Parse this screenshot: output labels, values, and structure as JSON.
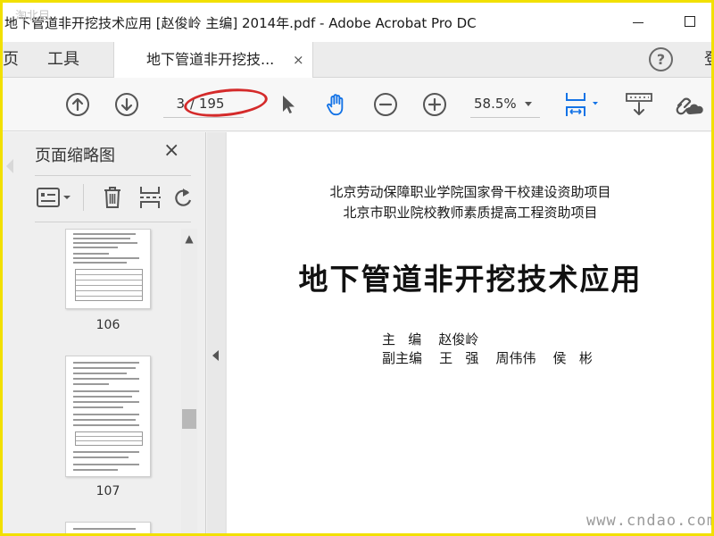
{
  "window": {
    "title": "地下管道非开挖技术应用 [赵俊岭 主编] 2014年.pdf - Adobe Acrobat Pro DC",
    "minimize_icon": "minimize-icon",
    "maximize_icon": "maximize-icon"
  },
  "tabs": {
    "home": "页",
    "tools": "工具",
    "document": "地下管道非开挖技...",
    "document_close": "×",
    "help": "?",
    "signin": "登"
  },
  "toolbar": {
    "prev_icon": "arrow-up-circle-icon",
    "next_icon": "arrow-down-circle-icon",
    "page_current": "3",
    "page_total": "/ 195",
    "select_icon": "cursor-arrow-icon",
    "hand_icon": "hand-tool-icon",
    "zoom_out_icon": "zoom-out-icon",
    "zoom_in_icon": "zoom-in-icon",
    "zoom_value": "58.5%",
    "fit_icon": "fit-page-icon",
    "scroll_icon": "scroll-mode-icon",
    "link_icon": "link-cloud-icon",
    "highlight_color": "#d42a2a",
    "accent_color": "#1473e6"
  },
  "thumbnails": {
    "title": "页面缩略图",
    "close": "×",
    "items": [
      {
        "page": "106"
      },
      {
        "page": "107"
      }
    ]
  },
  "document": {
    "subtitle_1": "北京劳动保障职业学院国家骨干校建设资助项目",
    "subtitle_2": "北京市职业院校教师素质提高工程资助项目",
    "title": "地下管道非开挖技术应用",
    "editor_line": "主   编    赵俊岭",
    "associate_editor_line": "副主编    王   强    周伟伟    侯   彬"
  },
  "watermark": "www.cndao.com",
  "corner_mark": "淘北目"
}
